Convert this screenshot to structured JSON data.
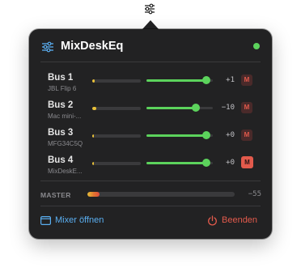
{
  "app": {
    "title": "MixDeskEq",
    "status_color": "#5cd35c"
  },
  "buses": [
    {
      "name": "Bus 1",
      "device": "JBL Flip 6",
      "meter_level": 0.05,
      "meter_color": "#e8c038",
      "volume": 0.9,
      "db": "+1",
      "mute_label": "M",
      "muted": false
    },
    {
      "name": "Bus 2",
      "device": "Mac mini-...",
      "meter_level": 0.08,
      "meter_color": "#e8c038",
      "volume": 0.74,
      "db": "−10",
      "mute_label": "M",
      "muted": false
    },
    {
      "name": "Bus 3",
      "device": "MFG34C5Q",
      "meter_level": 0.03,
      "meter_color": "#e8c038",
      "volume": 0.9,
      "db": "+0",
      "mute_label": "M",
      "muted": false
    },
    {
      "name": "Bus 4",
      "device": "MixDeskE...",
      "meter_level": 0.0,
      "meter_color": "#e8c038",
      "volume": 0.9,
      "db": "+0",
      "mute_label": "M",
      "muted": true
    }
  ],
  "master": {
    "label": "MASTER",
    "level": 0.08,
    "db": "−55"
  },
  "footer": {
    "open_label": "Mixer öffnen",
    "quit_label": "Beenden"
  },
  "colors": {
    "accent": "#5aaef0",
    "slider": "#5cd35c",
    "danger": "#e25a4c",
    "background": "#222223"
  }
}
